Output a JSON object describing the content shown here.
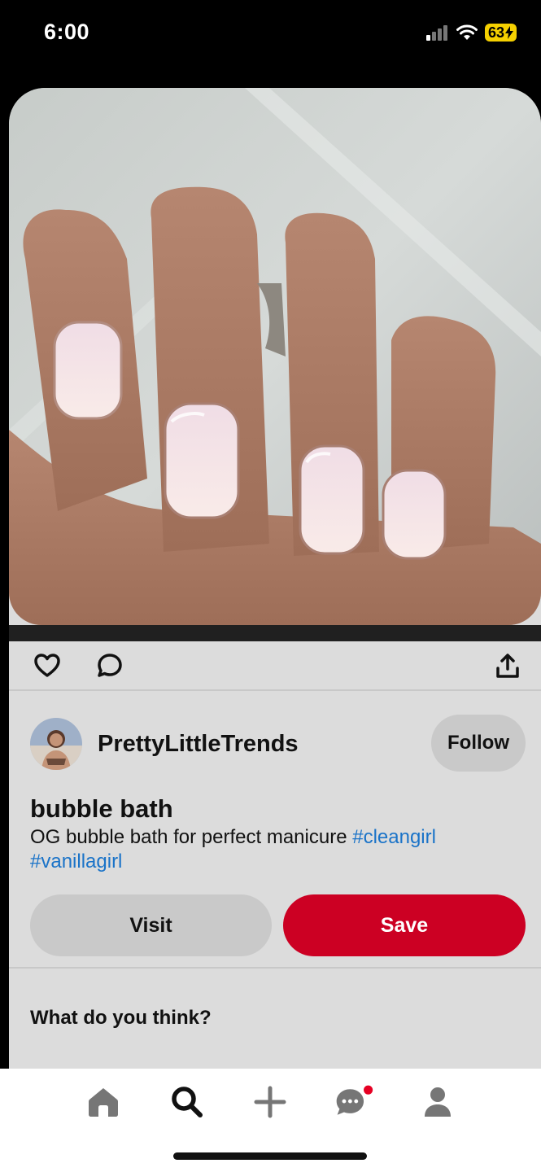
{
  "status": {
    "time": "6:00",
    "battery": "63"
  },
  "pin": {
    "creator": "PrettyLittleTrends",
    "follow_label": "Follow",
    "title": "bubble bath",
    "description": "OG bubble bath for perfect manicure ",
    "tags": [
      "#cleangirl",
      "#vanillagirl"
    ],
    "visit_label": "Visit",
    "save_label": "Save",
    "comment_prompt": "What do you think?"
  },
  "icons": {
    "actions": [
      "heart-icon",
      "comment-icon",
      "share-icon"
    ],
    "tabbar": [
      "home-icon",
      "search-icon",
      "plus-icon",
      "messages-icon",
      "profile-icon"
    ]
  },
  "colors": {
    "save": "#cc0023",
    "hashtag": "#1a73c8",
    "notification_dot": "#e60023"
  }
}
